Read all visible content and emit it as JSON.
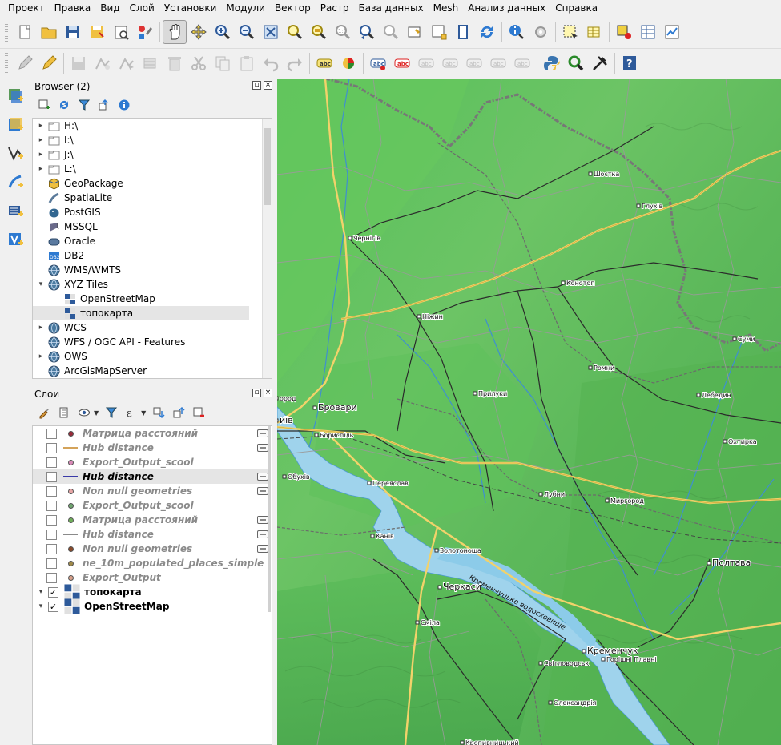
{
  "menu": [
    "Проект",
    "Правка",
    "Вид",
    "Слой",
    "Установки",
    "Модули",
    "Вектор",
    "Растр",
    "База данных",
    "Mesh",
    "Анализ данных",
    "Справка"
  ],
  "toolbar1": {
    "icons": [
      "new-project-icon",
      "open-project-icon",
      "save-project-icon",
      "save-as-icon",
      "print-layout-icon",
      "style-manager-icon",
      "pan-hand-icon",
      "pan-to-selection-icon",
      "zoom-in-icon",
      "zoom-out-icon",
      "zoom-full-icon",
      "zoom-to-selection-icon",
      "zoom-to-layer-icon",
      "zoom-native-icon",
      "zoom-last-icon",
      "zoom-next-icon",
      "new-map-view-icon",
      "new-3d-view-icon",
      "temporal-controller-icon",
      "refresh-icon",
      "identify-icon",
      "actions-icon",
      "select-features-icon",
      "attribute-table-icon",
      "deselect-icon",
      "open-attribute-table-icon",
      "statistics-icon"
    ]
  },
  "toolbar2": {
    "icons": [
      "edits-icon",
      "toggle-editing-icon",
      "save-edits-icon",
      "digitize-icon",
      "vertex-tool-icon",
      "modify-attributes-icon",
      "delete-selected-icon",
      "cut-features-icon",
      "copy-features-icon",
      "paste-features-icon",
      "undo-icon",
      "redo-icon",
      "label-tool-icon",
      "diagram-icon",
      "label-pin-icon",
      "label-highlight-icon",
      "label-show-hide-icon",
      "label-move-icon",
      "label-rotate-icon",
      "label-change-icon",
      "label-extra-icon",
      "python-console-icon",
      "zoom-processing-icon",
      "processing-toolbox-icon",
      "help-icon"
    ]
  },
  "left_toolbar": [
    "add-raster-icon",
    "add-wms-icon",
    "add-vector-icon",
    "add-delimited-icon",
    "add-spatialite-icon",
    "add-virtual-icon"
  ],
  "browser": {
    "title": "Browser (2)",
    "items": [
      {
        "label": "H:\\",
        "icon": "folder-icon",
        "caret": "▸",
        "indent": 0
      },
      {
        "label": "I:\\",
        "icon": "folder-icon",
        "caret": "▸",
        "indent": 0
      },
      {
        "label": "J:\\",
        "icon": "folder-icon",
        "caret": "▸",
        "indent": 0
      },
      {
        "label": "L:\\",
        "icon": "folder-icon",
        "caret": "▸",
        "indent": 0
      },
      {
        "label": "GeoPackage",
        "icon": "geopackage-icon",
        "caret": "",
        "indent": 0
      },
      {
        "label": "SpatiaLite",
        "icon": "spatialite-icon",
        "caret": "",
        "indent": 0
      },
      {
        "label": "PostGIS",
        "icon": "postgis-icon",
        "caret": "",
        "indent": 0
      },
      {
        "label": "MSSQL",
        "icon": "mssql-icon",
        "caret": "",
        "indent": 0
      },
      {
        "label": "Oracle",
        "icon": "oracle-icon",
        "caret": "",
        "indent": 0
      },
      {
        "label": "DB2",
        "icon": "db2-icon",
        "caret": "",
        "indent": 0
      },
      {
        "label": "WMS/WMTS",
        "icon": "globe-icon",
        "caret": "",
        "indent": 0
      },
      {
        "label": "XYZ Tiles",
        "icon": "globe-icon",
        "caret": "▾",
        "indent": 0
      },
      {
        "label": "OpenStreetMap",
        "icon": "xyz-tile-icon",
        "caret": "",
        "indent": 1
      },
      {
        "label": "топокарта",
        "icon": "xyz-tile-icon",
        "caret": "",
        "indent": 1,
        "selected": true
      },
      {
        "label": "WCS",
        "icon": "globe-icon",
        "caret": "▸",
        "indent": 0
      },
      {
        "label": "WFS / OGC API - Features",
        "icon": "globe-icon",
        "caret": "",
        "indent": 0
      },
      {
        "label": "OWS",
        "icon": "globe-icon",
        "caret": "▸",
        "indent": 0
      },
      {
        "label": "ArcGisMapServer",
        "icon": "globe-icon",
        "caret": "",
        "indent": 0
      }
    ]
  },
  "layers": {
    "title": "Слои",
    "items": [
      {
        "label": "Матрица расстояний",
        "sym": "dot",
        "color": "#9b2a3a",
        "checked": false,
        "filter": true
      },
      {
        "label": "Hub distance",
        "sym": "line",
        "color": "#d4a35a",
        "checked": false,
        "filter": true
      },
      {
        "label": "Export_Output_scool",
        "sym": "dot",
        "color": "#d98ab8",
        "checked": false,
        "filter": false
      },
      {
        "label": "Hub distance",
        "sym": "line",
        "color": "#3a3aa8",
        "checked": false,
        "filter": true,
        "current": true
      },
      {
        "label": "Non null geometries",
        "sym": "dot",
        "color": "#e8a6a6",
        "checked": false,
        "filter": true
      },
      {
        "label": "Export_Output_scool",
        "sym": "dot",
        "color": "#6fa56f",
        "checked": false,
        "filter": false
      },
      {
        "label": "Матрица расстояний",
        "sym": "dot",
        "color": "#6fae5a",
        "checked": false,
        "filter": true
      },
      {
        "label": "Hub distance",
        "sym": "line",
        "color": "#8a8a8a",
        "checked": false,
        "filter": true
      },
      {
        "label": "Non null geometries",
        "sym": "dot",
        "color": "#8a4a2a",
        "checked": false,
        "filter": true
      },
      {
        "label": "ne_10m_populated_places_simple",
        "sym": "dot",
        "color": "#a08a4a",
        "checked": false,
        "filter": false
      },
      {
        "label": "Export_Output",
        "sym": "dot",
        "color": "#d8a08a",
        "checked": false,
        "filter": false
      },
      {
        "label": "топокарта",
        "sym": "tile",
        "color": "#333333",
        "checked": true,
        "filter": false,
        "raster": true
      },
      {
        "label": "OpenStreetMap",
        "sym": "tile",
        "color": "#333333",
        "checked": true,
        "filter": false,
        "raster": true
      }
    ]
  },
  "map": {
    "cities": [
      {
        "name": "Шостка"
      },
      {
        "name": "Глухів"
      },
      {
        "name": "Чернігів"
      },
      {
        "name": "Конотоп"
      },
      {
        "name": "Ніжин"
      },
      {
        "name": "Суми"
      },
      {
        "name": "Ромни"
      },
      {
        "name": "Прилуки"
      },
      {
        "name": "Лебедин"
      },
      {
        "name": "ород"
      },
      {
        "name": "Бровари"
      },
      {
        "name": "иїв"
      },
      {
        "name": "Бориспіль"
      },
      {
        "name": "Охтирка"
      },
      {
        "name": "Обухів"
      },
      {
        "name": "Переяслав"
      },
      {
        "name": "Лубни"
      },
      {
        "name": "Миргород"
      },
      {
        "name": "Канів"
      },
      {
        "name": "Золотоноша"
      },
      {
        "name": "Полтава"
      },
      {
        "name": "Черкаси"
      },
      {
        "name": "Сміла"
      },
      {
        "name": "Кременчук"
      },
      {
        "name": "Світловодськ"
      },
      {
        "name": "Горішні Плавні"
      },
      {
        "name": "Олександрія"
      },
      {
        "name": "Кропивницький"
      }
    ],
    "reservoir_label": "Кременчуцьке водосховище"
  }
}
